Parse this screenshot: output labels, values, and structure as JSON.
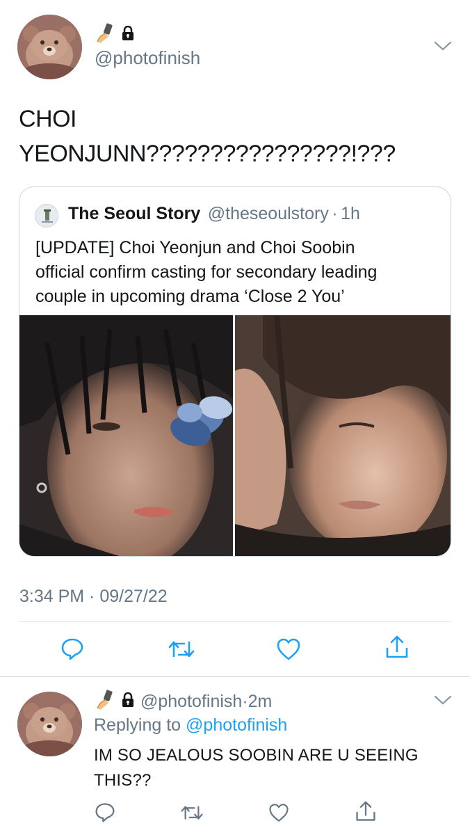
{
  "main_tweet": {
    "emoji_icons": [
      "selfie-phone-icon",
      "lock-icon"
    ],
    "handle": "@photofinish",
    "text_line1": "CHOI",
    "text_line2": "YEONJUNN????????????????!???",
    "timestamp": "3:34 PM · 09/27/22"
  },
  "quoted_tweet": {
    "name": "The Seoul Story",
    "handle": "@theseoulstory",
    "separator": "·",
    "time": "1h",
    "text_line1": "[UPDATE] Choi Yeonjun and Choi Soobin",
    "text_line2": "official confirm casting for secondary leading",
    "text_line3": "couple in upcoming drama ‘Close 2 You’"
  },
  "actions": [
    "reply-icon",
    "retweet-icon",
    "like-icon",
    "share-icon"
  ],
  "reply_tweet": {
    "handle": "@photofinish",
    "separator": "·",
    "time": "2m",
    "replying_prefix": "Replying to",
    "replying_handle": "@photofinish",
    "text_line1": "IM SO JEALOUS SOOBIN ARE U SEEING",
    "text_line2": "THIS??"
  },
  "colors": {
    "link": "#1da1f2",
    "secondary_text": "#657786",
    "border": "#ccd6dd"
  }
}
